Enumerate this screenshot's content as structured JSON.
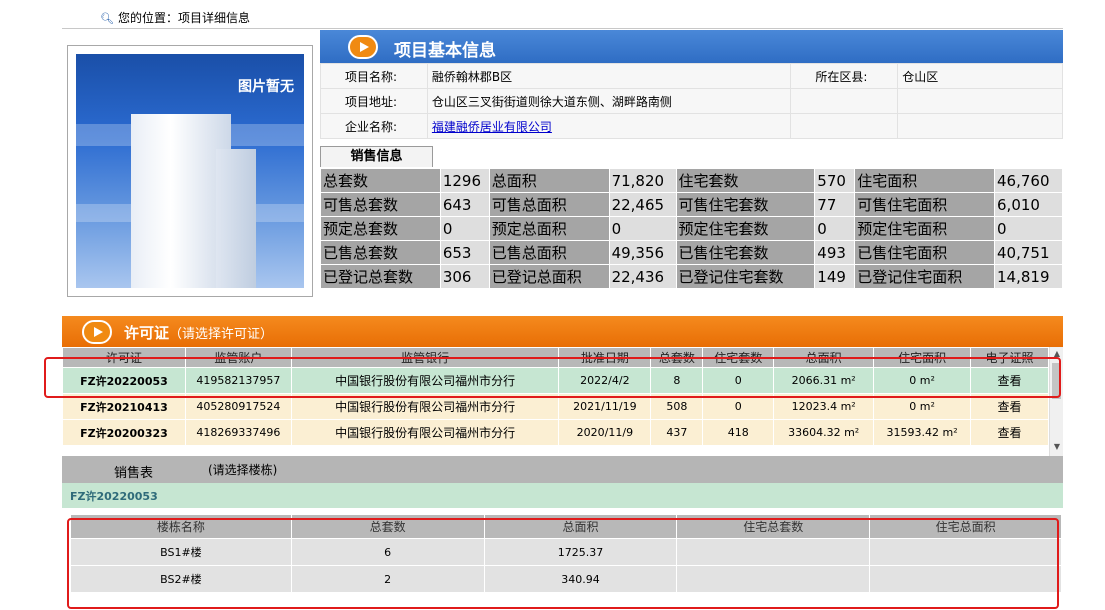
{
  "breadcrumb": "您的位置：项目详细信息",
  "image_placeholder": "图片暂无",
  "basic_section_title": "项目基本信息",
  "basic": {
    "name_label": "项目名称:",
    "name_value": "融侨翰林郡B区",
    "district_label": "所在区县:",
    "district_value": "仓山区",
    "address_label": "项目地址:",
    "address_value": "仓山区三叉街街道则徐大道东侧、湖畔路南侧",
    "company_label": "企业名称:",
    "company_value": "福建融侨居业有限公司"
  },
  "sales_tab": "销售信息",
  "sales_rows": [
    [
      [
        "总套数",
        "1296"
      ],
      [
        "总面积",
        "71,820"
      ],
      [
        "住宅套数",
        "570"
      ],
      [
        "住宅面积",
        "46,760"
      ]
    ],
    [
      [
        "可售总套数",
        "643"
      ],
      [
        "可售总面积",
        "22,465"
      ],
      [
        "可售住宅套数",
        "77"
      ],
      [
        "可售住宅面积",
        "6,010"
      ]
    ],
    [
      [
        "预定总套数",
        "0"
      ],
      [
        "预定总面积",
        "0"
      ],
      [
        "预定住宅套数",
        "0"
      ],
      [
        "预定住宅面积",
        "0"
      ]
    ],
    [
      [
        "已售总套数",
        "653"
      ],
      [
        "已售总面积",
        "49,356"
      ],
      [
        "已售住宅套数",
        "493"
      ],
      [
        "已售住宅面积",
        "40,751"
      ]
    ],
    [
      [
        "已登记总套数",
        "306"
      ],
      [
        "已登记总面积",
        "22,436"
      ],
      [
        "已登记住宅套数",
        "149"
      ],
      [
        "已登记住宅面积",
        "14,819"
      ]
    ]
  ],
  "permit_section": {
    "title": "许可证",
    "subtitle": "（请选择许可证）"
  },
  "permit_columns": [
    "许可证",
    "监管账户",
    "监管银行",
    "批准日期",
    "总套数",
    "住宅套数",
    "总面积",
    "住宅面积",
    "电子证照"
  ],
  "permits": [
    {
      "id": "FZ许20220053",
      "account": "419582137957",
      "bank": "中国银行股份有限公司福州市分行",
      "date": "2022/4/2",
      "total": "8",
      "res": "0",
      "area": "2066.31 m²",
      "res_area": "0 m²",
      "view": "查看"
    },
    {
      "id": "FZ许20210413",
      "account": "405280917524",
      "bank": "中国银行股份有限公司福州市分行",
      "date": "2021/11/19",
      "total": "508",
      "res": "0",
      "area": "12023.4 m²",
      "res_area": "0 m²",
      "view": "查看"
    },
    {
      "id": "FZ许20200323",
      "account": "418269337496",
      "bank": "中国银行股份有限公司福州市分行",
      "date": "2020/11/9",
      "total": "437",
      "res": "418",
      "area": "33604.32 m²",
      "res_area": "31593.42 m²",
      "view": "查看"
    }
  ],
  "sales_table": {
    "title": "销售表",
    "hint": "(请选择楼栋)",
    "selected_permit": "FZ许20220053"
  },
  "building_columns": [
    "楼栋名称",
    "总套数",
    "总面积",
    "住宅总套数",
    "住宅总面积"
  ],
  "buildings": [
    {
      "name": "BS1#楼",
      "units": "6",
      "area": "1725.37",
      "res_units": "",
      "res_area": ""
    },
    {
      "name": "BS2#楼",
      "units": "2",
      "area": "340.94",
      "res_units": "",
      "res_area": ""
    }
  ],
  "colors": {
    "blue_header": "#2f6dc4",
    "orange_header": "#e86e05",
    "selected_row": "#c6e6d2",
    "highlight_box": "#e01b1b"
  }
}
